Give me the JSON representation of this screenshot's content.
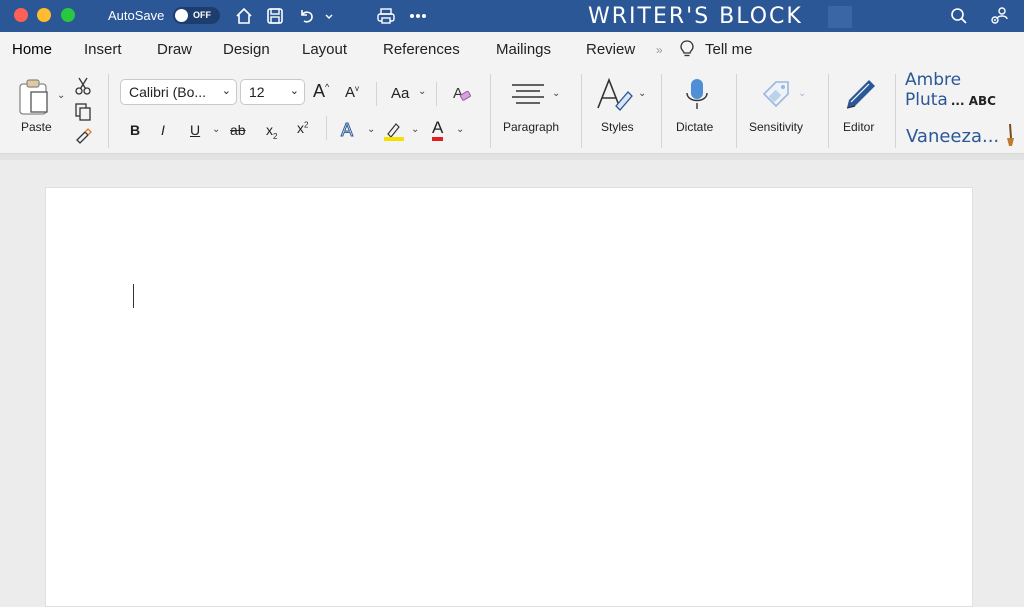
{
  "titlebar": {
    "autosave_label": "AutoSave",
    "autosave_state": "OFF",
    "doc_title": "WRITER'S    BLOCK",
    "accent_color": "#2b5797"
  },
  "tabs": [
    {
      "label": "Home",
      "active": true
    },
    {
      "label": "Insert"
    },
    {
      "label": "Draw"
    },
    {
      "label": "Design"
    },
    {
      "label": "Layout"
    },
    {
      "label": "References"
    },
    {
      "label": "Mailings"
    },
    {
      "label": "Review"
    }
  ],
  "tell_me": "Tell me",
  "ribbon": {
    "paste_label": "Paste",
    "font_name": "Calibri (Bo...",
    "font_size": "12",
    "change_case_label": "Aa",
    "bold": "B",
    "italic": "I",
    "underline": "U",
    "strikethrough": "ab",
    "subscript": "x",
    "superscript": "x",
    "grow_font": "A",
    "shrink_font": "A",
    "text_effects": "A",
    "font_color": "A",
    "paragraph_label": "Paragraph",
    "styles_label": "Styles",
    "dictate_label": "Dictate",
    "sensitivity_label": "Sensitivity",
    "editor_label": "Editor",
    "highlight_color": "#f5e000",
    "font_color_hex": "#e02020"
  },
  "profile": {
    "line1": "Ambre",
    "line2": "Pluta",
    "line2_suffix": "... ABC",
    "line3": "Vaneeza..."
  }
}
